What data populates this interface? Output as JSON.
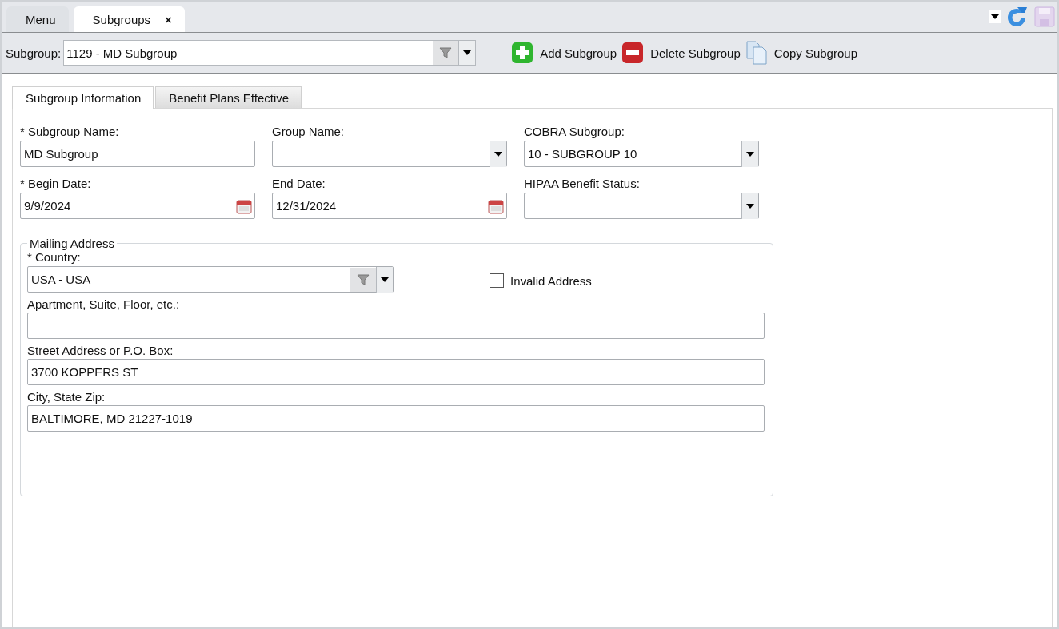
{
  "doc_tabs": [
    {
      "label": "Menu",
      "selected": false
    },
    {
      "label": "Subgroups",
      "selected": true,
      "close": "×"
    }
  ],
  "toolbar": {
    "picker": {
      "label": "Subgroup:",
      "value": "1129 - MD Subgroup"
    },
    "actions": [
      {
        "kind": "add",
        "label": "Add Subgroup"
      },
      {
        "kind": "delete",
        "label": "Delete Subgroup"
      },
      {
        "kind": "copy",
        "label": "Copy Subgroup"
      }
    ]
  },
  "tabs": [
    {
      "label": "Subgroup Information",
      "selected": true
    },
    {
      "label": "Benefit Plans Effective",
      "selected": false
    }
  ],
  "fields": [
    {
      "kind": "text",
      "label": "* Subgroup Name:",
      "value": "MD Subgroup"
    },
    {
      "kind": "dropdown",
      "label": "Group Name:"
    },
    {
      "kind": "dropdown",
      "label": "COBRA Subgroup:",
      "value": "10 - SUBGROUP 10"
    },
    {
      "kind": "date",
      "label": "* Begin Date:",
      "value": "9/9/2024"
    },
    {
      "kind": "date",
      "label": "End Date:",
      "value": "12/31/2024"
    },
    {
      "kind": "dropdown",
      "label": "HIPAA Benefit Status:"
    }
  ],
  "mailing_address": {
    "legend": "Mailing Address",
    "country": {
      "label": "* Country:",
      "value": "USA - USA"
    },
    "invalid_address": {
      "label": "Invalid Address",
      "checked": false
    },
    "fields": [
      {
        "label": "Apartment, Suite, Floor, etc.:"
      },
      {
        "label": "Street Address or P.O. Box:",
        "value": "3700 KOPPERS ST"
      },
      {
        "label": "City, State Zip:",
        "value": "BALTIMORE, MD 21227-1019"
      }
    ]
  }
}
